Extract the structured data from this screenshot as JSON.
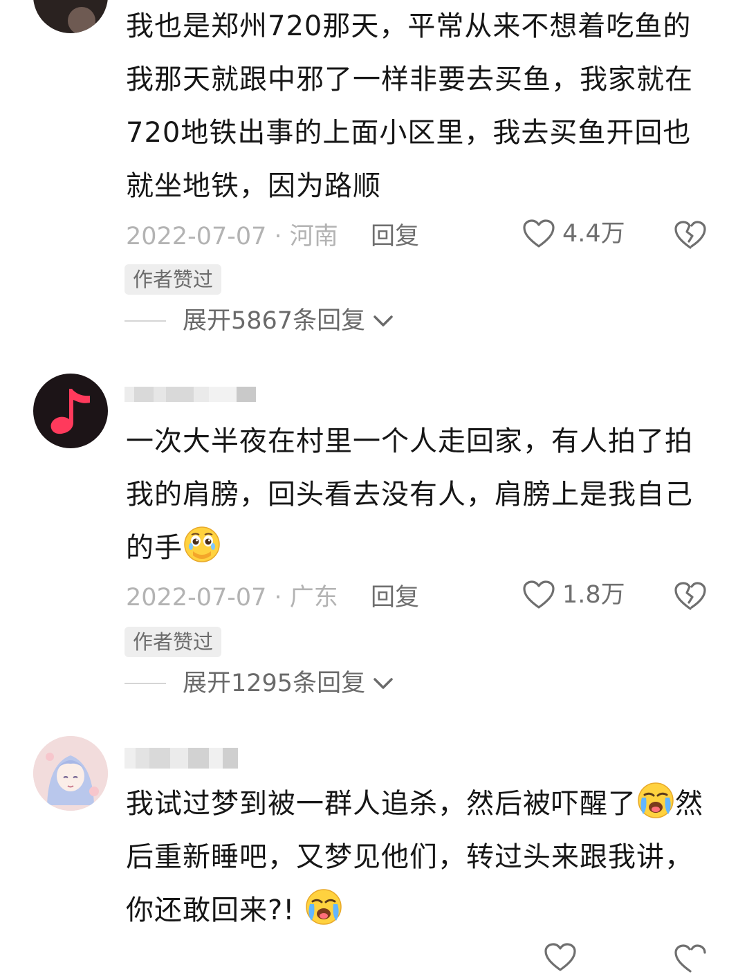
{
  "comments": [
    {
      "content": "我也是郑州720那天，平常从来不想着吃鱼的我那天就跟中邪了一样非要去买鱼，我家就在720地铁出事的上面小区里，我去买鱼开回也就坐地铁，因为路顺",
      "date_location": "2022-07-07 · 河南",
      "reply_label": "回复",
      "likes": "4.4万",
      "author_tag": "作者赞过",
      "expand_label": "展开5867条回复"
    },
    {
      "content_text": "一次大半夜在村里一个人走回家，有人拍了拍我的肩膀，回头看去没有人，肩膀上是我自己的手",
      "emoji": "face-holding-back-tears",
      "date_location": "2022-07-07 · 广东",
      "reply_label": "回复",
      "likes": "1.8万",
      "author_tag": "作者赞过",
      "expand_label": "展开1295条回复"
    },
    {
      "content_text_1": "我试过梦到被一群人追杀，然后被吓醒了",
      "content_text_2": "然后重新睡吧，又梦见他们，转过头来跟我讲，你还敢回来?!",
      "emoji": "crying-face"
    }
  ],
  "icons": {
    "like": "heart-outline-icon",
    "dislike": "broken-heart-icon",
    "expand": "chevron-down-icon"
  },
  "colors": {
    "text": "#161616",
    "meta": "#b3b3b3",
    "secondary": "#6f6f6f",
    "tag_bg": "#eeeeee",
    "music_avatar_bg": "#1c1417",
    "music_note": "#ff3a5c"
  }
}
